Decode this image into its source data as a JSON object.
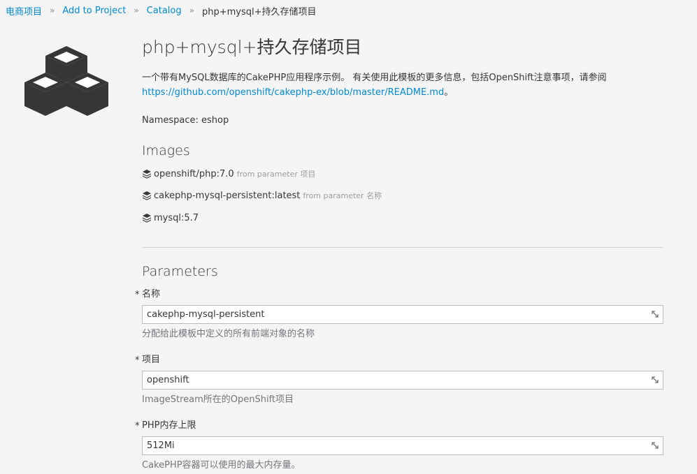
{
  "breadcrumb": {
    "items": [
      "电商项目",
      "Add to Project",
      "Catalog"
    ],
    "current": "php+mysql+持久存储项目"
  },
  "template": {
    "title": "php+mysql+持久存储项目",
    "description": "一个带有MySQL数据库的CakePHP应用程序示例。 有关使用此模板的更多信息，包括OpenShift注意事项，请参阅",
    "readme_link": "https://github.com/openshift/cakephp-ex/blob/master/README.md",
    "readme_suffix": "。",
    "namespace_label": "Namespace:",
    "namespace_value": "eshop",
    "icon": "cubes-icon"
  },
  "images": {
    "title": "Images",
    "items": [
      {
        "name": "openshift/php:7.0",
        "meta": "from parameter 项目"
      },
      {
        "name": "cakephp-mysql-persistent:latest",
        "meta": "from parameter 名称"
      },
      {
        "name": "mysql:5.7",
        "meta": ""
      }
    ]
  },
  "parameters": {
    "title": "Parameters",
    "items": [
      {
        "label": "名称",
        "value": "cakephp-mysql-persistent",
        "help": "分配给此模板中定义的所有前端对象的名称"
      },
      {
        "label": "项目",
        "value": "openshift",
        "help": "ImageStream所在的OpenShift项目"
      },
      {
        "label": "PHP内存上限",
        "value": "512Mi",
        "help": "CakePHP容器可以使用的最大内存量。"
      }
    ],
    "required_marker": "*"
  },
  "colors": {
    "link": "#0088ce",
    "text": "#363636",
    "muted": "#72767b",
    "background": "#f5f5f5"
  }
}
